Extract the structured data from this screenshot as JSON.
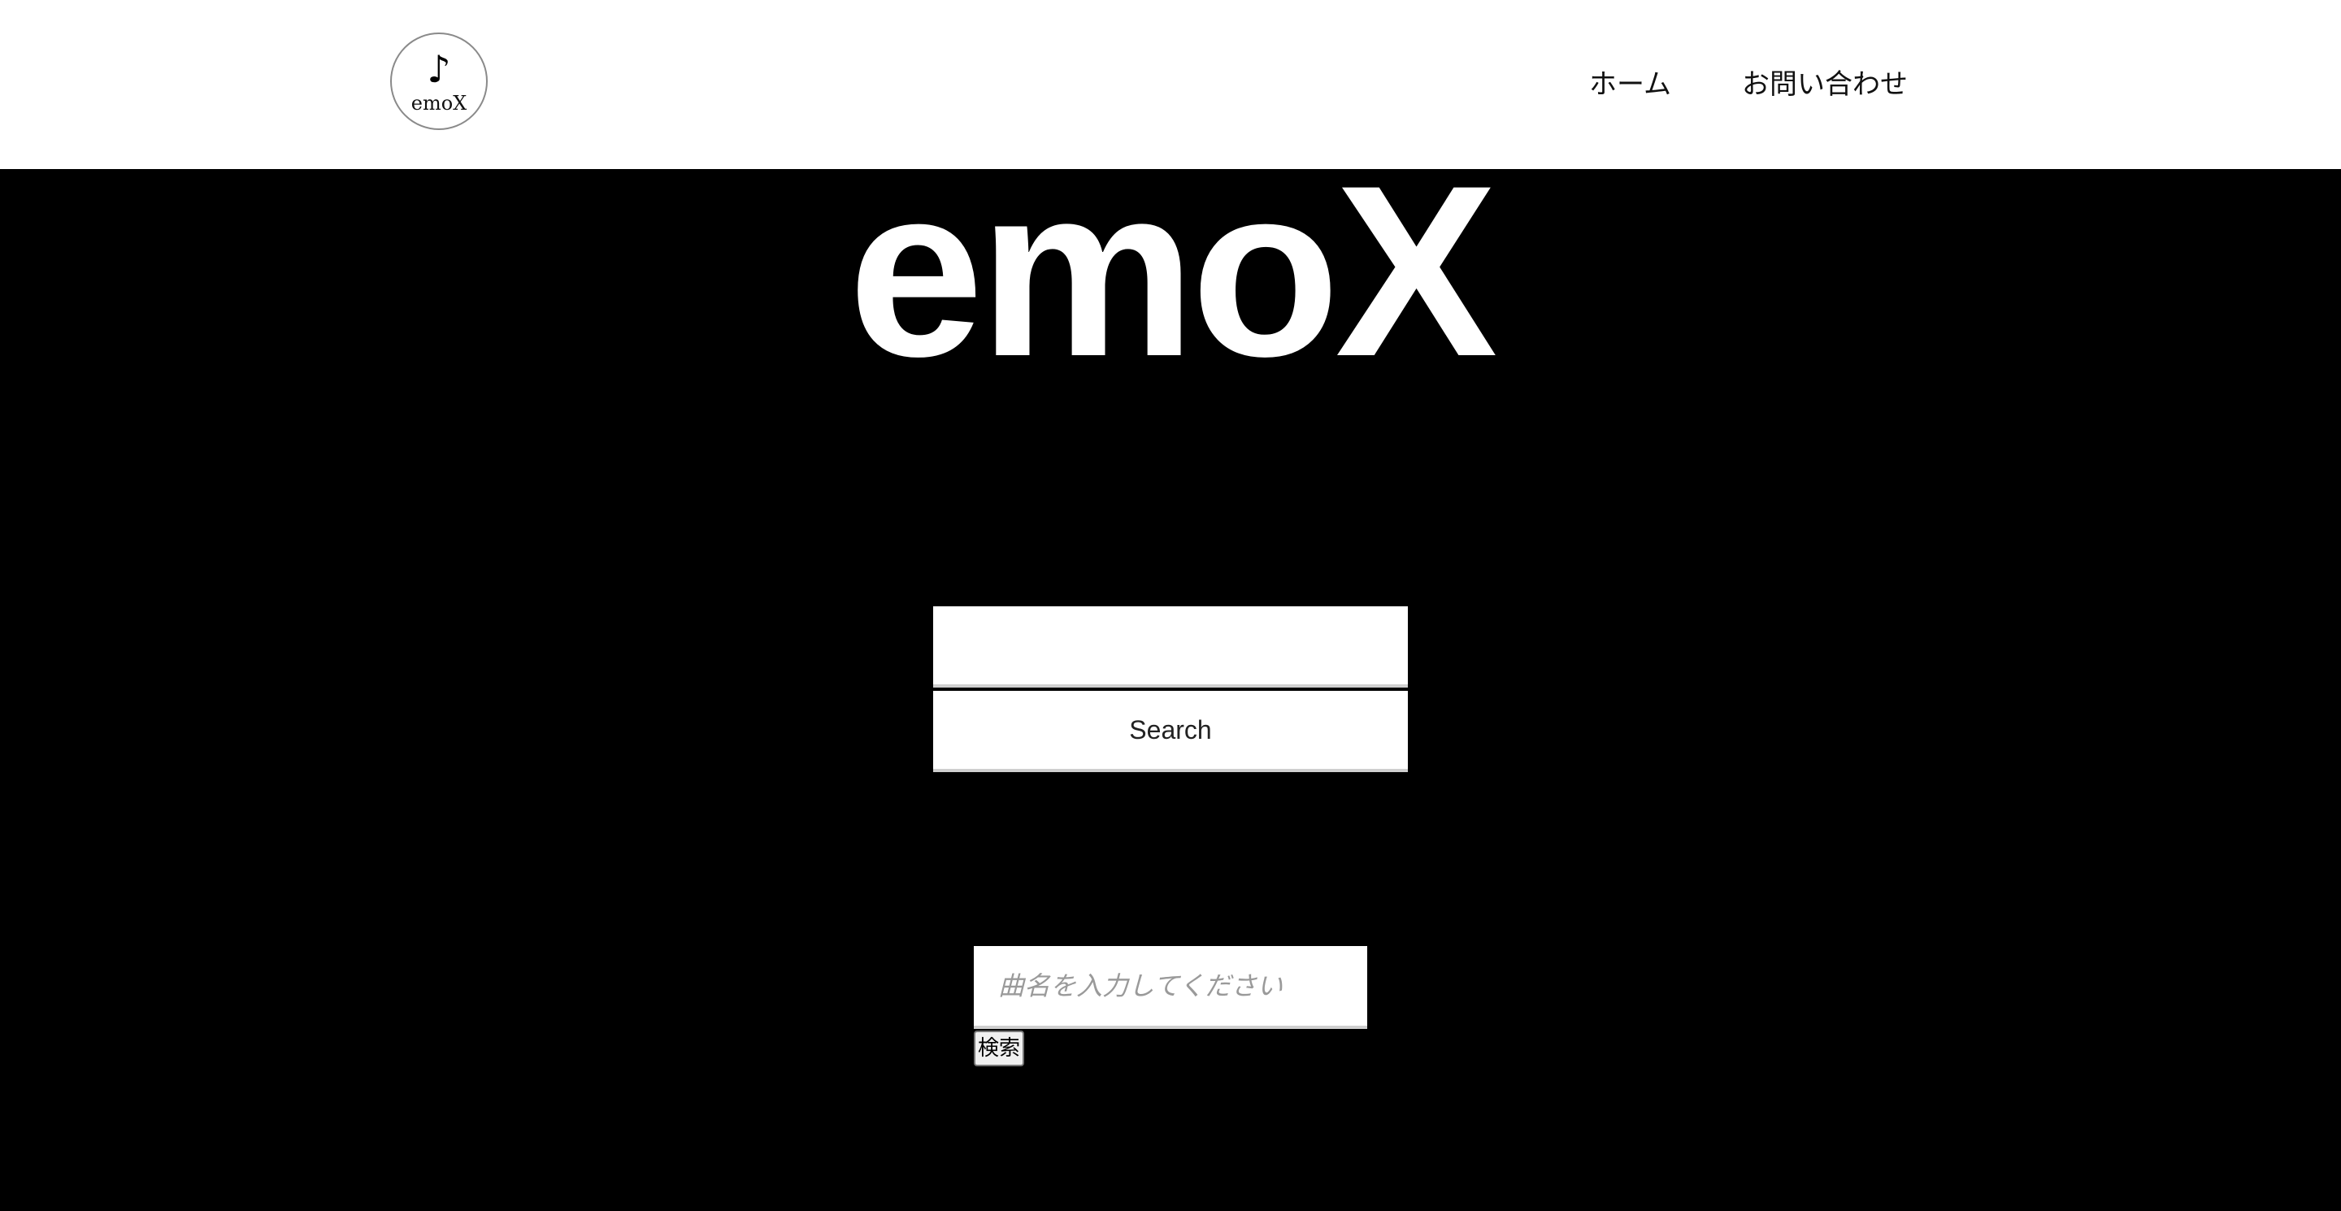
{
  "header": {
    "logo": {
      "icon": "music-note-icon",
      "glyph": "♪",
      "text": "emoX"
    },
    "nav": [
      {
        "label": "ホーム"
      },
      {
        "label": "お問い合わせ"
      }
    ]
  },
  "hero": {
    "title": "emoX",
    "search": {
      "input_value": "",
      "input_placeholder": "",
      "button_label": "Search"
    },
    "song_search": {
      "input_value": "",
      "input_placeholder": "曲名を入力してください",
      "button_label": "検索"
    }
  },
  "colors": {
    "header_background": "#ffffff",
    "hero_background": "#000000",
    "title_color": "#ffffff"
  }
}
